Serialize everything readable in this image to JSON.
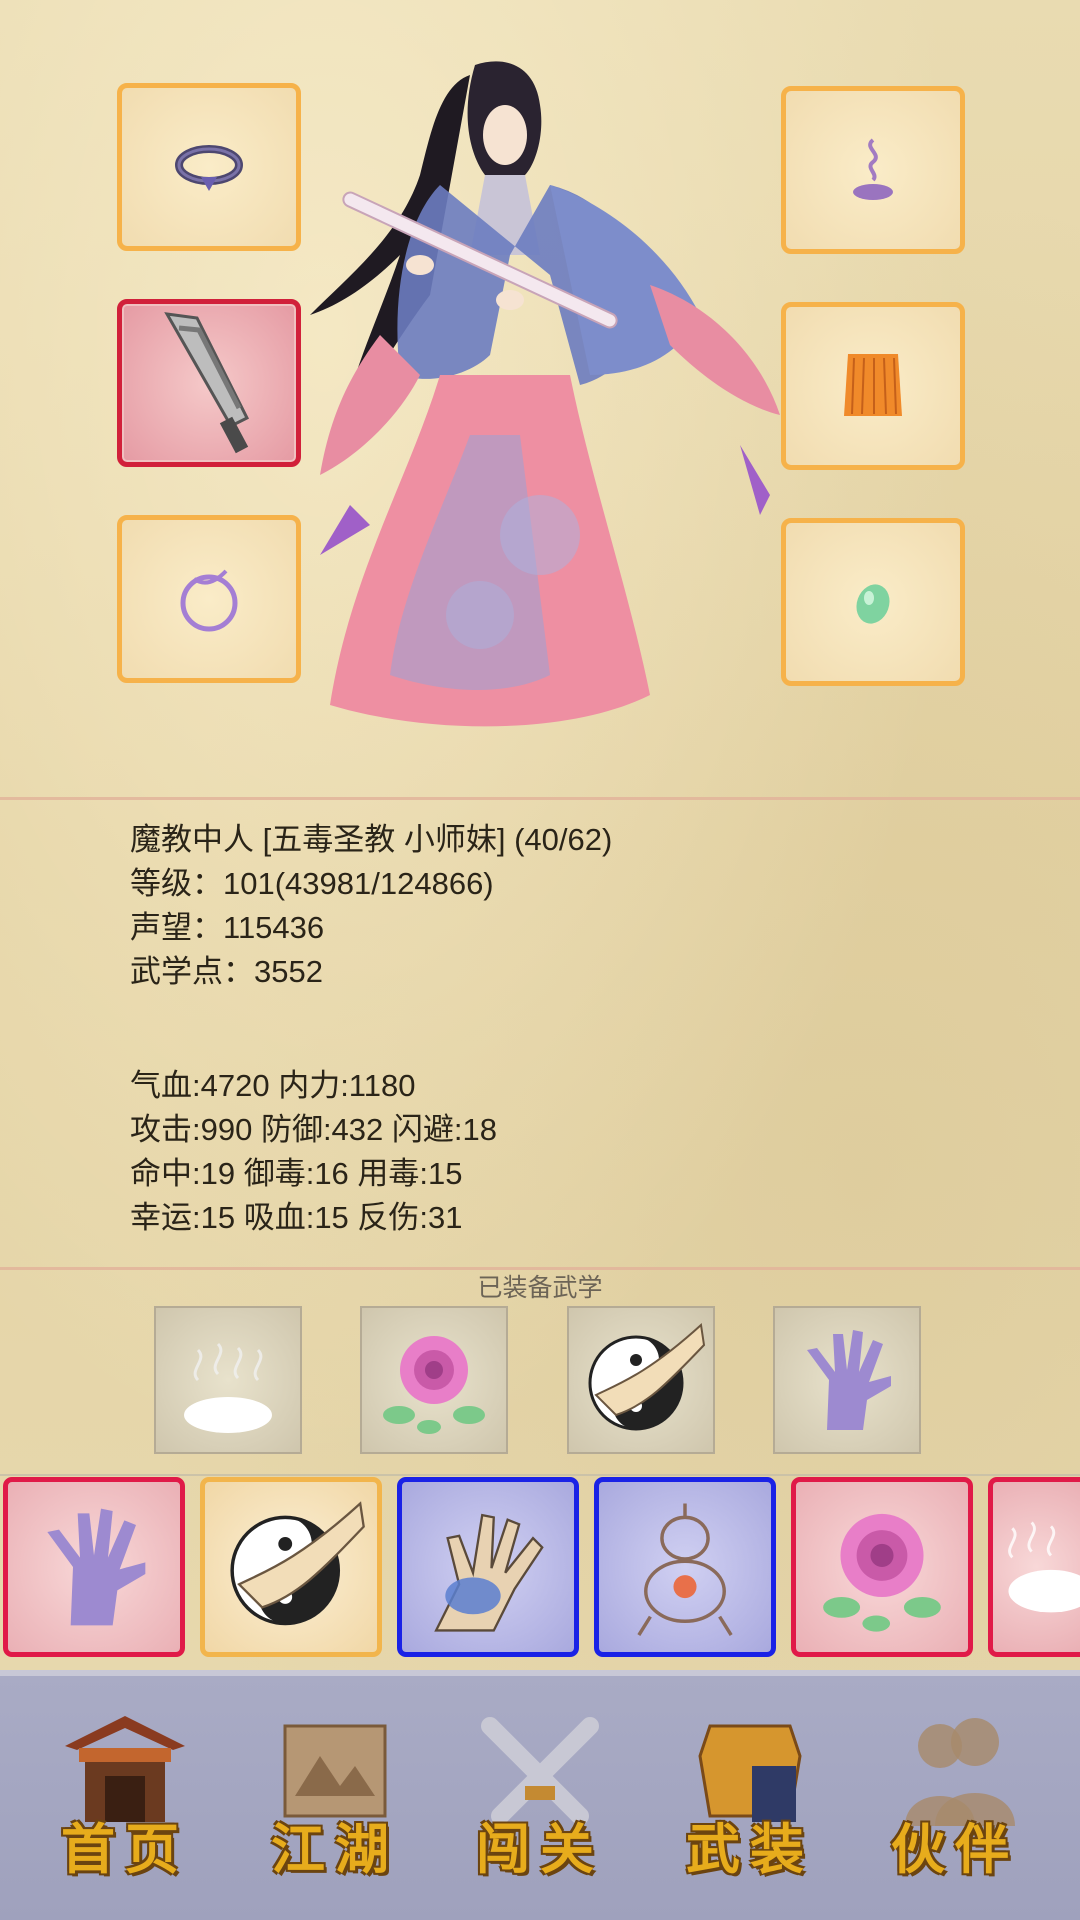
{
  "character": {
    "title_line": "魔教中人 [五毒圣教 小师妹] (40/62)",
    "level_line": "等级：101(43981/124866)",
    "fame_line": "声望：115436",
    "martial_points_line": "武学点：3552"
  },
  "stats": {
    "line1": "气血:4720  内力:1180",
    "line2": "攻击:990  防御:432  闪避:18",
    "line3": "命中:19  御毒:16  用毒:15",
    "line4": "幸运:15  吸血:15  反伤:31"
  },
  "equipped_section_label": "已装备武学",
  "equipment_slots": [
    {
      "icon": "ring-icon"
    },
    {
      "icon": "incense-icon"
    },
    {
      "icon": "sword-icon"
    },
    {
      "icon": "cape-icon"
    },
    {
      "icon": "bracelet-icon"
    },
    {
      "icon": "jade-icon"
    }
  ],
  "equipped_skills": [
    "mist-icon",
    "rose-icon",
    "yin-yang-fist-icon",
    "purple-palm-icon"
  ],
  "skill_cards": [
    {
      "icon": "purple-palm-icon",
      "rarity": "red"
    },
    {
      "icon": "yin-yang-fist-icon",
      "rarity": "gold"
    },
    {
      "icon": "poison-hand-icon",
      "rarity": "blue"
    },
    {
      "icon": "gourd-icon",
      "rarity": "blue"
    },
    {
      "icon": "rose-icon",
      "rarity": "red"
    },
    {
      "icon": "mist-icon",
      "rarity": "red"
    }
  ],
  "nav": {
    "home": "首页",
    "jianghu": "江湖",
    "challenge": "闯关",
    "equipment": "武装",
    "partner": "伙伴"
  },
  "colors": {
    "slot_border": "#f6b24a",
    "red_border": "#d1203a",
    "blue_border": "#1a22e6",
    "nav_text": "#e7ac1c",
    "nav_bg": "#a3a5c0"
  }
}
